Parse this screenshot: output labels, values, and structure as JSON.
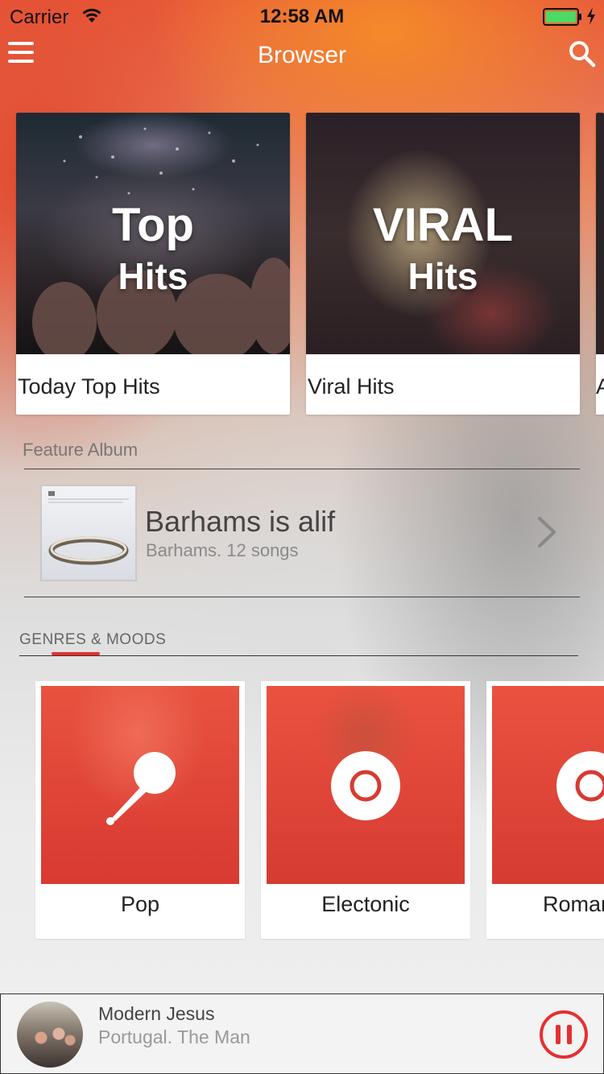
{
  "status": {
    "carrier": "Carrier",
    "time": "12:58 AM"
  },
  "nav": {
    "title": "Browser",
    "menu_icon": "hamburger-icon",
    "search_icon": "search-icon"
  },
  "playlists": [
    {
      "art_line1": "Top",
      "art_line2": "Hits",
      "label": "Today Top Hits"
    },
    {
      "art_line1": "VIRAL",
      "art_line2": "Hits",
      "label": "Viral Hits"
    },
    {
      "art_line1": "",
      "art_line2": "",
      "label": "A"
    }
  ],
  "feature": {
    "section_title": "Feature Album",
    "album_title": "Barhams is alif",
    "album_subtitle": "Barhams. 12 songs"
  },
  "genres": {
    "section_title": "GENRES & MOODS",
    "items": [
      {
        "label": "Pop",
        "icon": "microphone-icon"
      },
      {
        "label": "Electonic",
        "icon": "vinyl-disc-icon"
      },
      {
        "label": "Roman",
        "icon": "vinyl-disc-icon"
      }
    ]
  },
  "player": {
    "title": "Modern Jesus",
    "artist": "Portugal. The Man",
    "control_icon": "pause-icon"
  },
  "colors": {
    "accent": "#e53030",
    "genre_tint": "#e5473b"
  }
}
